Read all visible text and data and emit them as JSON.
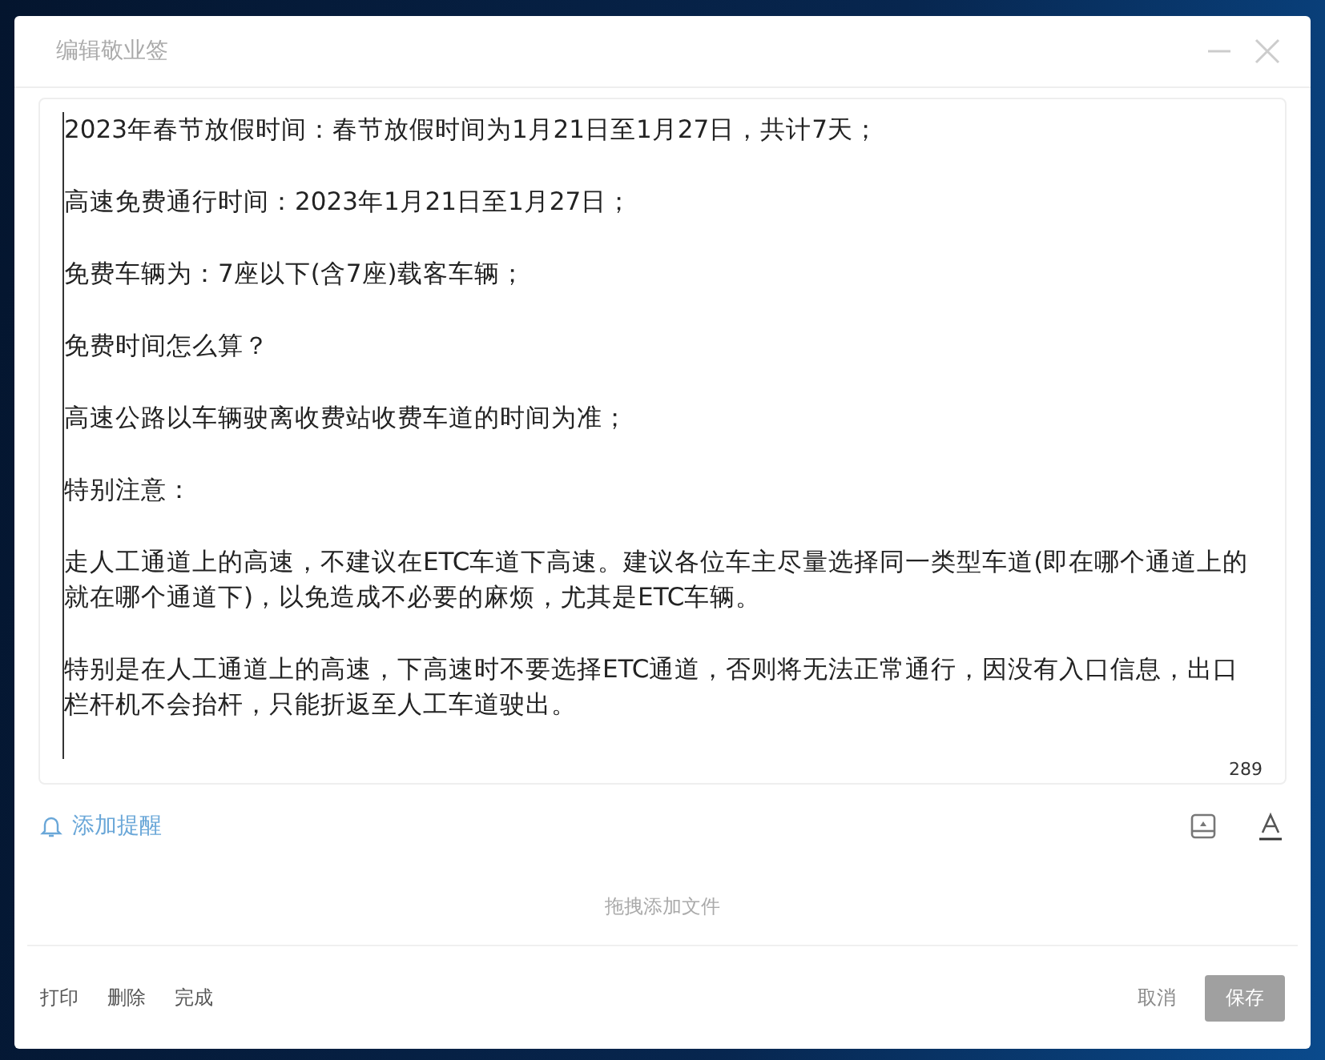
{
  "window": {
    "title": "编辑敬业签"
  },
  "note": {
    "paragraphs": [
      "2023年春节放假时间：春节放假时间为1月21日至1月27日，共计7天；",
      "高速免费通行时间：2023年1月21日至1月27日；",
      "免费车辆为：7座以下(含7座)载客车辆；",
      "免费时间怎么算？",
      "高速公路以车辆驶离收费站收费车道的时间为准；",
      "特别注意：",
      "走人工通道上的高速，不建议在ETC车道下高速。建议各位车主尽量选择同一类型车道(即在哪个通道上的就在哪个通道下)，以免造成不必要的麻烦，尤其是ETC车辆。",
      "特别是在人工通道上的高速，下高速时不要选择ETC通道，否则将无法正常通行，因没有入口信息，出口栏杆机不会抬杆，只能折返至人工车道驶出。"
    ],
    "count": "289"
  },
  "toolbar": {
    "reminder": "添加提醒"
  },
  "dropzone": {
    "text": "拖拽添加文件"
  },
  "footer": {
    "left_actions": [
      "打印",
      "删除",
      "完成"
    ],
    "cancel": "取消",
    "save": "保存"
  }
}
